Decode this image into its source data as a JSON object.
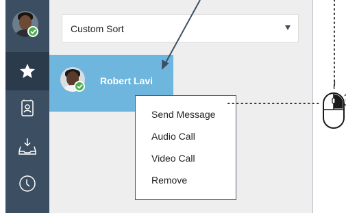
{
  "sidebar": {
    "items": [
      {
        "icon": "star-icon",
        "active": true
      },
      {
        "icon": "address-book-icon",
        "active": false
      },
      {
        "icon": "inbox-download-icon",
        "active": false
      },
      {
        "icon": "clock-icon",
        "active": false
      }
    ]
  },
  "sort": {
    "label": "Custom Sort"
  },
  "contact": {
    "name": "Robert Lavi",
    "status": "online"
  },
  "context_menu": {
    "items": [
      "Send Message",
      "Audio Call",
      "Video Call",
      "Remove"
    ]
  },
  "colors": {
    "sidebar": "#3c4f62",
    "sidebar_active": "#2b3b4b",
    "contact_highlight": "#6eb6de",
    "online_badge": "#4caf50"
  }
}
